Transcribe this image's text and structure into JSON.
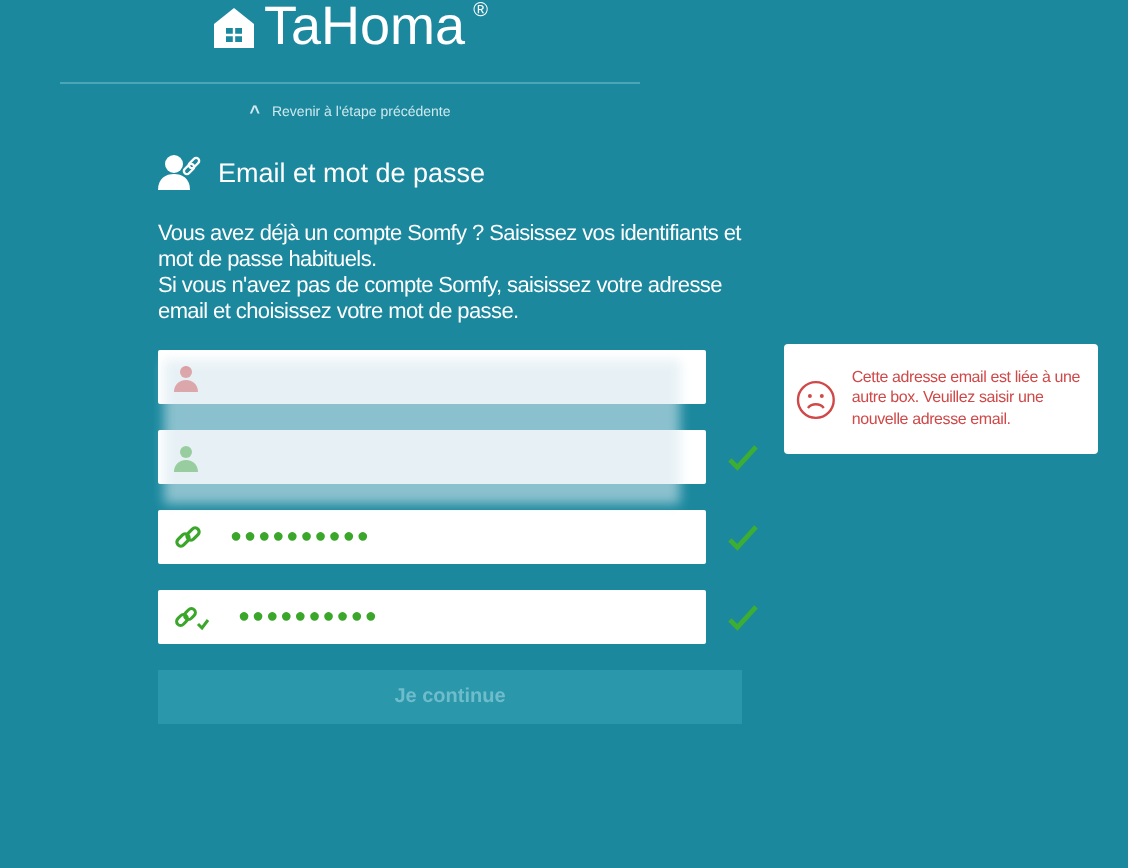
{
  "brand": {
    "name": "TaHoma",
    "mark": "®"
  },
  "back_link": {
    "arrow": "^",
    "label": "Revenir à l'étape précédente"
  },
  "section": {
    "title": "Email et mot de passe"
  },
  "intro": [
    "Vous avez déjà un compte Somfy ? Saisissez vos identifiants et mot de passe habituels.",
    "Si vous n'avez pas de compte Somfy, saisissez votre adresse email et choisissez votre mot de passe."
  ],
  "fields": [
    {
      "kind": "user",
      "valid": false
    },
    {
      "kind": "user",
      "valid": true
    },
    {
      "kind": "password",
      "valid": true,
      "value": "●●●●●●●●●●"
    },
    {
      "kind": "confirm",
      "valid": true,
      "value": "●●●●●●●●●●"
    }
  ],
  "error_tip": {
    "text": "Cette adresse email est liée à une autre box. Veuillez saisir une nouvelle adresse email."
  },
  "submit": {
    "label": "Je continue",
    "disabled": true
  }
}
